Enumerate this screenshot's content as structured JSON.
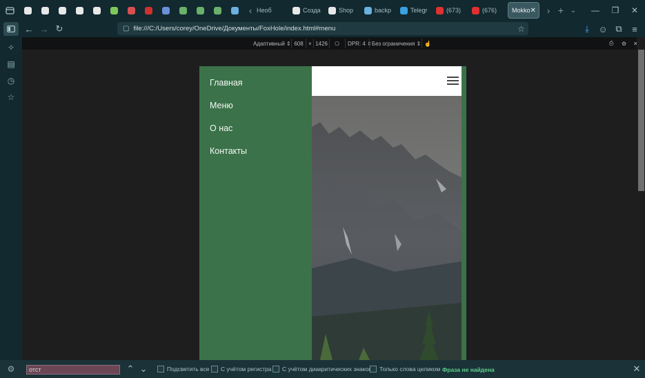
{
  "tabs": [
    {
      "icon": "hammer-icon",
      "color": "#e8e8e8",
      "label": ""
    },
    {
      "icon": "hammer-icon",
      "color": "#e8e8e8",
      "label": ""
    },
    {
      "icon": "hammer-icon",
      "color": "#e8e8e8",
      "label": ""
    },
    {
      "icon": "k-logo-icon",
      "color": "#e8e8e8",
      "label": ""
    },
    {
      "icon": "up-logo-icon",
      "color": "#e8e8e8",
      "label": ""
    },
    {
      "icon": "seven-logo-icon",
      "color": "#7ec85a",
      "label": ""
    },
    {
      "icon": "red-app-icon",
      "color": "#d95050",
      "label": ""
    },
    {
      "icon": "hh-logo-icon",
      "color": "#d03030",
      "label": ""
    },
    {
      "icon": "globe-icon",
      "color": "#6b8fd8",
      "label": ""
    },
    {
      "icon": "w-logo-icon",
      "color": "#6ab06a",
      "label": ""
    },
    {
      "icon": "w-logo-icon",
      "color": "#6ab06a",
      "label": ""
    },
    {
      "icon": "w-logo-icon",
      "color": "#6ab06a",
      "label": ""
    },
    {
      "icon": "wave-icon",
      "color": "#6ab0e0",
      "label": ""
    }
  ],
  "labeled_tabs": [
    {
      "icon": "k-logo-icon",
      "color": "#e8e8e8",
      "label": "Созда"
    },
    {
      "icon": "k-logo-icon",
      "color": "#e8e8e8",
      "label": "Shop"
    },
    {
      "icon": "wave-icon",
      "color": "#6ab0e0",
      "label": "backp"
    },
    {
      "icon": "telegram-icon",
      "color": "#3aa0e0",
      "label": "Telegr"
    },
    {
      "icon": "youtube-icon",
      "color": "#e03030",
      "label": "(673)"
    },
    {
      "icon": "youtube-icon",
      "color": "#e03030",
      "label": "(676)"
    }
  ],
  "tab_prefix": "Необ",
  "active_tab": {
    "label": "Mokko"
  },
  "address": {
    "url": "file:///C:/Users/corey/OneDrive/Документы/FoxHole/index.html#menu"
  },
  "devbar": {
    "mode": "Адаптивный",
    "width": "608",
    "times": "×",
    "height": "1426",
    "dpr": "DPR: 4",
    "throttle": "Без ограничения"
  },
  "site": {
    "nav": [
      "Главная",
      "Меню",
      "О нас",
      "Контакты"
    ]
  },
  "find": {
    "query": "отст",
    "highlight_all": "Подсветить все",
    "match_case": "С учётом регистра",
    "diacritics": "С учётом диакритических знаков",
    "whole_words": "Только слова целиком",
    "status": "Фраза не найдена"
  },
  "colors": {
    "site_green": "#3b7249",
    "status_green": "#5fd08c",
    "chrome_bg": "#11292f"
  }
}
